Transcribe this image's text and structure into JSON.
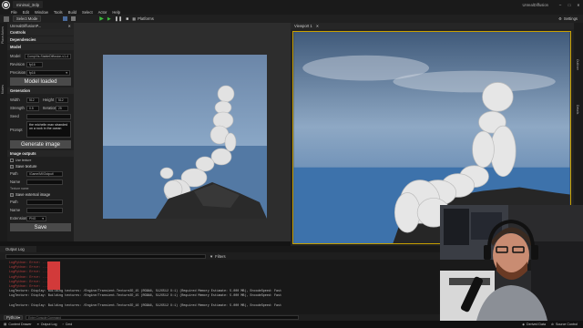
{
  "titlebar": {
    "project_tab": "minimal_3rdp",
    "window_title": "UnrealDiffusion",
    "menu": [
      "File",
      "Edit",
      "Window",
      "Tools",
      "Build",
      "Select",
      "Actor",
      "Help"
    ]
  },
  "toolbar": {
    "mode_label": "Select Mode",
    "platforms_label": "Platforms",
    "settings_label": "Settings"
  },
  "left_panel": {
    "tab_label": "UnrealDiffusionP...",
    "vertical_tabs": [
      "Place Actors",
      "Modes"
    ],
    "sections": {
      "controls": "Controls",
      "dependencies": "Dependencies",
      "model": "Model",
      "generation": "Generation",
      "image_outputs": "Image outputs"
    },
    "model": {
      "model_label": "Model",
      "model_value": "CompVis-StableDiffusion-v1-4",
      "revision_label": "Revision",
      "revision_value": "fp16",
      "precision_label": "Precision",
      "precision_value": "fp16",
      "model_loaded_btn": "Model loaded"
    },
    "generation": {
      "width_label": "Width",
      "width_value": "512",
      "height_label": "Height",
      "height_value": "512",
      "strength_label": "Strength",
      "strength_value": "0.5",
      "iterations_label": "Iterations",
      "iterations_value": "25",
      "seed_label": "Seed",
      "seed_value": "",
      "prompt_label": "Prompt",
      "prompt_value": "the michelin man stranded on a rock in the ocean",
      "generate_btn": "Generate image"
    },
    "outputs": {
      "texture_cb": "Use texture",
      "save_texture": "Save texture",
      "path_label": "Path",
      "path_value": "/Game/MI/Output/",
      "name_label": "Name",
      "name_value": "",
      "name_placeholder": "Texture name",
      "save_external": "Save external image",
      "path2_value": "",
      "name2_value": "",
      "extension_label": "Extension",
      "extension_value": "PNG",
      "save_btn": "Save"
    }
  },
  "viewport": {
    "tab_label": "Viewport 1",
    "right_tabs": [
      "Outliner",
      "Details"
    ]
  },
  "output_log": {
    "tab_label": "Output Log",
    "filters_label": "Filters",
    "lines": [
      "LogPython: Error: ...",
      "LogPython: Error: ...",
      "LogPython: Error: ...",
      "LogPython: Error: ...",
      "LogPython: Error: ...",
      "LogPython: Error: ...",
      "LogTexture: Display: Building textures: /Engine/Transient.Texture2D_15 (RGBA8, 512X512 X:1) (Required Memory Estimate: 5.000 MB), EncodeSpeed: Fast",
      "LogTexture: Display: Building textures: /Engine/Transient.Texture2D_15 (RGBA8, 512X512 X:1) (Required Memory Estimate: 5.000 MB), EncodeSpeed: Fast",
      "",
      "LogTexture: Display: Building textures: /Engine/Transient.Texture2D_16 (RGBA8, 512X512 X:1) (Required Memory Estimate: 5.000 MB), EncodeSpeed: Fast"
    ],
    "cmd_label": "Python",
    "cmd_placeholder": "Enter Console Command"
  },
  "statusbar": {
    "content_drawer": "Content Drawer",
    "output_log": "Output Log",
    "cmd": "Cmd",
    "derived_data": "Derived Data",
    "source_control": "Source Control"
  },
  "colors": {
    "accent_green": "#3cba3c",
    "error_red": "#d23a3a",
    "log_text": "#c0c0c0"
  }
}
